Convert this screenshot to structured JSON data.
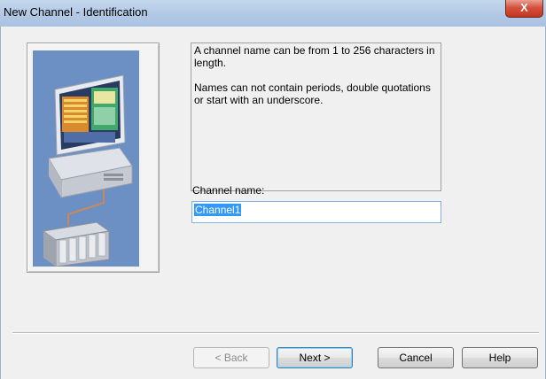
{
  "window": {
    "title": "New Channel - Identification",
    "close_glyph": "X"
  },
  "info": {
    "paragraph1": "A channel name can be from 1 to 256 characters in length.",
    "paragraph2": "Names can not contain periods, double quotations or start with an underscore."
  },
  "channel_name": {
    "label": "Channel name:",
    "value": "Channel1",
    "selected": true
  },
  "buttons": {
    "back": "< Back",
    "next": "Next >",
    "cancel": "Cancel",
    "help": "Help"
  },
  "illustration": {
    "icon": "computer-network-plc-illustration",
    "background_color": "#6c8fc4"
  }
}
